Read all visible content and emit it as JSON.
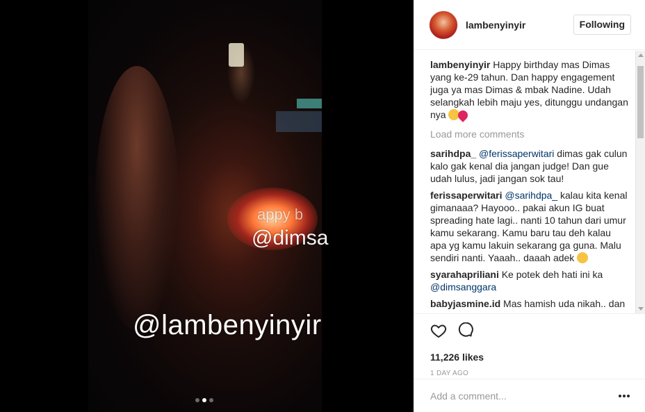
{
  "media": {
    "overlay_main": "@lambenyinyir",
    "overlay_dims": "@dimsa",
    "overlay_happy": "appy b",
    "dots_count": 3,
    "active_dot": 1
  },
  "header": {
    "username": "lambenyinyir",
    "follow_label": "Following"
  },
  "caption": {
    "author": "lambenyinyir",
    "text": "Happy birthday mas Dimas yang ke-29 tahun. Dan happy engagement juga ya mas Dimas & mbak Nadine. Udah selangkah lebih maju yes, ditunggu undangan nya"
  },
  "load_more": "Load more comments",
  "comments": [
    {
      "author": "sarihdpa_",
      "mention": "@ferissaperwitari",
      "text": " dimas gak culun kalo gak kenal dia jangan judge! Dan gue udah lulus, jadi jangan sok tau!"
    },
    {
      "author": "ferissaperwitari",
      "mention": "@sarihdpa_",
      "text": " kalau kita kenal gimanaaa? Hayooo.. pakai akun IG buat spreading hate lagi.. nanti 10 tahun dari umur kamu sekarang. Kamu baru tau deh kalau apa yg kamu lakuin sekarang ga guna. Malu sendiri nanti. Yaaah.. daaah adek"
    },
    {
      "author": "syarahapriliani",
      "text": "Ke potek deh hati ini ka ",
      "mention": "@dimsanggara"
    },
    {
      "author": "babyjasmine.id",
      "text": "Mas hamish uda nikah.. dan"
    }
  ],
  "actions": {
    "likes": "11,226 likes",
    "time": "1 DAY AGO"
  },
  "add_comment": {
    "placeholder": "Add a comment..."
  }
}
